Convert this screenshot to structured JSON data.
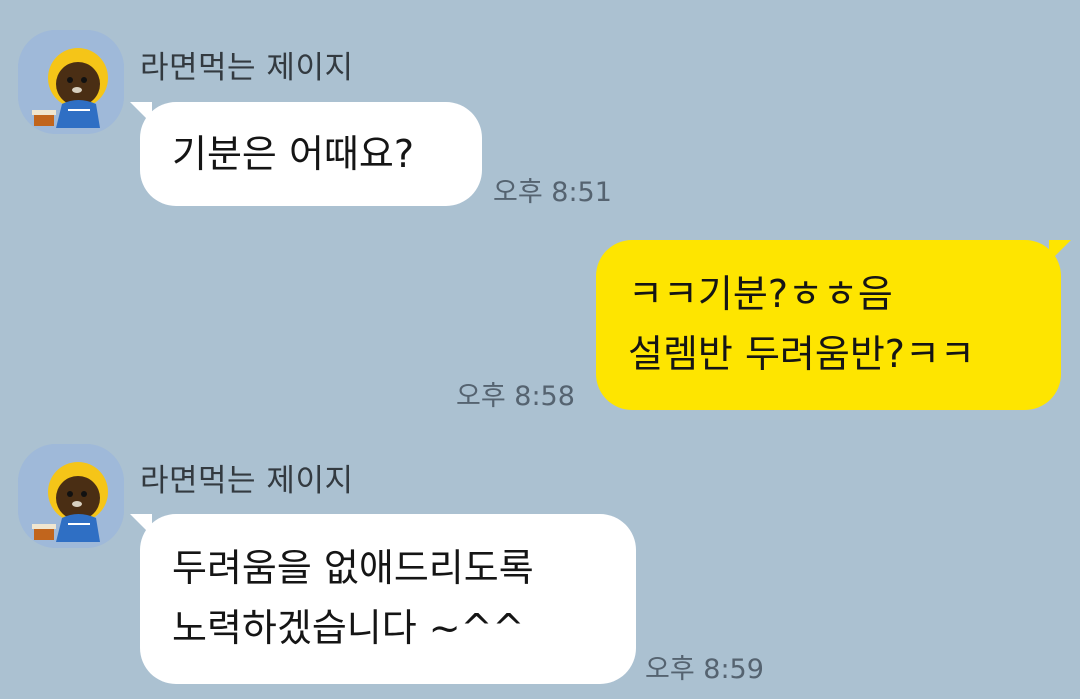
{
  "messages": [
    {
      "sender": "라면먹는 제이지",
      "text_lines": [
        "기분은 어때요?"
      ],
      "time": "오후 8:51",
      "direction": "incoming"
    },
    {
      "text_lines": [
        "ㅋㅋ기분?ㅎㅎ음",
        "설렘반 두려움반?ㅋㅋ"
      ],
      "time": "오후 8:58",
      "direction": "outgoing"
    },
    {
      "sender": "라면먹는 제이지",
      "text_lines": [
        "두려움을 없애드리도록",
        "노력하겠습니다 ~^^"
      ],
      "time": "오후 8:59",
      "direction": "incoming"
    }
  ],
  "colors": {
    "background": "#abc1d1",
    "incoming_bubble": "#ffffff",
    "outgoing_bubble": "#fee500",
    "avatar_background": "#9fb9d9"
  },
  "icons": {
    "avatar": "ryan-ramen-character-avatar"
  }
}
